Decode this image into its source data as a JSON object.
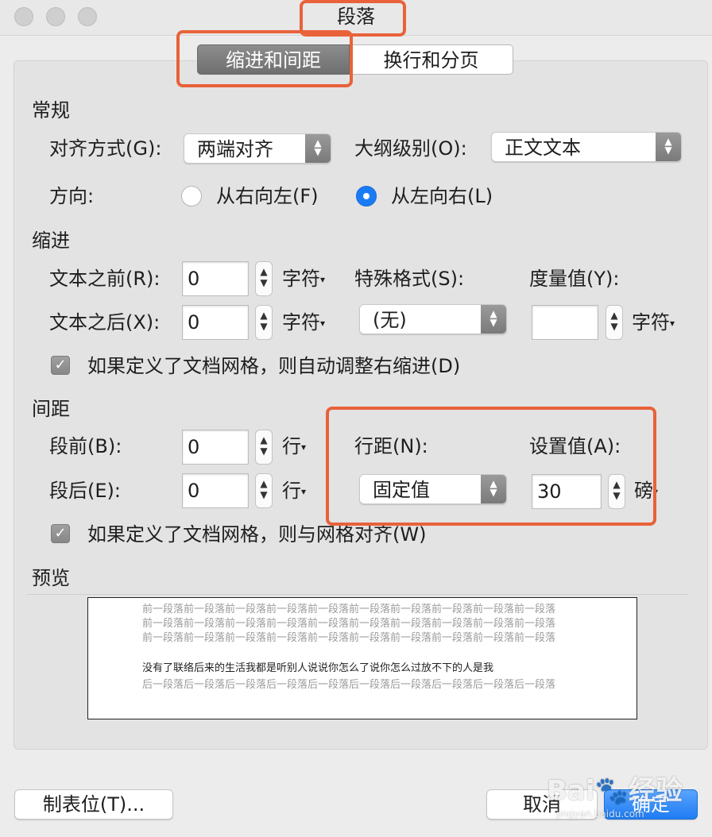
{
  "window": {
    "title": "段落"
  },
  "tabs": [
    {
      "label": "缩进和间距",
      "active": true
    },
    {
      "label": "换行和分页",
      "active": false
    }
  ],
  "general": {
    "section": "常规",
    "alignment_label": "对齐方式(G):",
    "alignment_value": "两端对齐",
    "outline_label": "大纲级别(O):",
    "outline_value": "正文文本",
    "direction_label": "方向:",
    "direction_rtl": "从右向左(F)",
    "direction_ltr": "从左向右(L)",
    "direction_selected": "ltr"
  },
  "indent": {
    "section": "缩进",
    "before_label": "文本之前(R):",
    "before_value": "0",
    "before_unit": "字符",
    "after_label": "文本之后(X):",
    "after_value": "0",
    "after_unit": "字符",
    "special_label": "特殊格式(S):",
    "special_value": "(无)",
    "measure_label": "度量值(Y):",
    "measure_value": "",
    "measure_unit": "字符",
    "auto_adjust_label": "如果定义了文档网格，则自动调整右缩进(D)",
    "auto_adjust_checked": true
  },
  "spacing": {
    "section": "间距",
    "before_label": "段前(B):",
    "before_value": "0",
    "before_unit": "行",
    "after_label": "段后(E):",
    "after_value": "0",
    "after_unit": "行",
    "line_label": "行距(N):",
    "line_value": "固定值",
    "setting_label": "设置值(A):",
    "setting_value": "30",
    "setting_unit": "磅",
    "snap_label": "如果定义了文档网格，则与网格对齐(W)",
    "snap_checked": true
  },
  "preview": {
    "section": "预览",
    "before_lines": [
      "前一段落前一段落前一段落前一段落前一段落前一段落前一段落前一段落前一段落前一段落",
      "前一段落前一段落前一段落前一段落前一段落前一段落前一段落前一段落前一段落前一段落",
      "前一段落前一段落前一段落前一段落前一段落前一段落前一段落前一段落前一段落前一段落"
    ],
    "main_text": "没有了联络后来的生活我都是听别人说说你怎么了说你怎么过放不下的人是我",
    "after_line": "后一段落后一段落后一段落后一段落后一段落后一段落后一段落后一段落后一段落后一段落"
  },
  "buttons": {
    "tabs_button": "制表位(T)...",
    "cancel": "取消",
    "ok": "确定"
  },
  "watermark": {
    "text": "Bai",
    "text2": "经验",
    "sub": "jingyan.baidu.com"
  },
  "colors": {
    "accent": "#1a7cf5",
    "highlight": "#e8623a"
  }
}
